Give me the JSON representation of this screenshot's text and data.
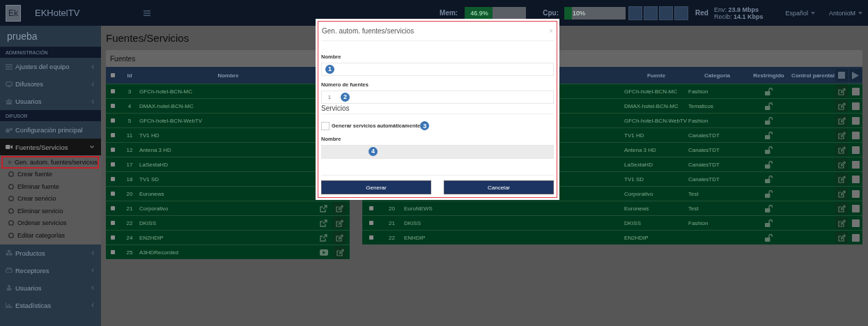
{
  "topbar": {
    "logo": "Ek",
    "brand": "EKHotelTV",
    "mem": {
      "label": "Mem:",
      "reading": "46.9%",
      "level": 0.45
    },
    "cpu": {
      "label": "Cpu:",
      "reading": "10%",
      "level": 0.12
    },
    "network": {
      "label": "Red",
      "sent": "Env: **23.9 Mbps**",
      "received": "Recib: **14.1 Kbps**"
    },
    "language": "Español",
    "user": "AntonioM"
  },
  "sidebar": {
    "title": "prueba",
    "sections": [
      {
        "header": "ADMINISTRACIÓN",
        "items": [
          {
            "label": "Ajustes del equipo",
            "kind": "list",
            "expanded": false
          },
          {
            "label": "Difusores",
            "kind": "monitor",
            "expanded": false
          },
          {
            "label": "Usuarios",
            "kind": "users",
            "expanded": false
          }
        ]
      },
      {
        "header": "DIFUSOR",
        "items": [
          {
            "label": "Configuración principal",
            "kind": "gears"
          },
          {
            "label": "Fuentes/Servicios",
            "kind": "video",
            "expanded": true,
            "children": [
              {
                "label": "Gen. autom. fuentes/servicios",
                "selected": true
              },
              {
                "label": "Crear fuente",
                "selected": false
              },
              {
                "label": "Eliminar fuente",
                "selected": false
              },
              {
                "label": "Crear servicio",
                "selected": false
              },
              {
                "label": "Eliminar servicio",
                "selected": false
              },
              {
                "label": "Ordenar servicios",
                "selected": false
              },
              {
                "label": "Editar categorías",
                "selected": false
              }
            ]
          },
          {
            "label": "Productos",
            "kind": "cubes",
            "expanded": false
          },
          {
            "label": "Receptores",
            "kind": "printer",
            "expanded": false
          },
          {
            "label": "Usuarios",
            "kind": "user",
            "expanded": false
          },
          {
            "label": "Estadísticas",
            "kind": "chart",
            "expanded": false
          }
        ]
      }
    ]
  },
  "page_title": "Fuentes/Servicios",
  "sources": {
    "title": "Fuentes",
    "all_checked": false,
    "columns": [
      "Id",
      "Nombre"
    ],
    "rows": [
      {
        "id": "3",
        "name": "GFCh-hotel-BCN-MC",
        "checked": false
      },
      {
        "id": "4",
        "name": "DMAX-hotel-BCN-MC",
        "checked": false
      },
      {
        "id": "5",
        "name": "GFCh-hotel-BCN-WebTV",
        "checked": false
      },
      {
        "id": "11",
        "name": "TV1 HD",
        "checked": false
      },
      {
        "id": "12",
        "name": "Antena 3 HD",
        "checked": false
      },
      {
        "id": "17",
        "name": "LaSextaHD",
        "checked": false
      },
      {
        "id": "18",
        "name": "TV1 SD",
        "checked": false
      },
      {
        "id": "20",
        "name": "Euronews",
        "checked": false
      },
      {
        "id": "21",
        "name": "Corporativo",
        "checked": false,
        "kind": "link"
      },
      {
        "id": "22",
        "name": "DKISS",
        "checked": false,
        "kind": "link"
      },
      {
        "id": "24",
        "name": "EN2HDIP",
        "checked": false,
        "kind": "link"
      },
      {
        "id": "25",
        "name": "A3HDRecorded",
        "checked": false,
        "kind": "video"
      }
    ]
  },
  "services": {
    "columns": [
      "Fuente",
      "Categoría",
      "Restringido",
      "Control parental"
    ],
    "rows": [
      {
        "fuente": "GFCh-hotel-BCN-MC",
        "categoria": "Fashion",
        "restricted": false
      },
      {
        "fuente": "DMAX-hotel-BCN-MC",
        "categoria": "Tematicos",
        "restricted": false
      },
      {
        "fuente": "GFCh-hotel-BCN-WebTV",
        "categoria": "Fashion",
        "restricted": false
      },
      {
        "fuente": "TV1 HD",
        "categoria": "CanalesTDT",
        "restricted": false
      },
      {
        "fuente": "Antena 3 HD",
        "categoria": "CanalesTDT",
        "restricted": false
      },
      {
        "fuente": "LaSextaHD",
        "categoria": "CanalesTDT",
        "restricted": false
      },
      {
        "fuente": "TV1 SD",
        "categoria": "CanalesTDT",
        "restricted": false
      },
      {
        "fuente": "Corporativo",
        "categoria": "Test",
        "restricted": false
      },
      {
        "id": "20",
        "name": "EuroNEWS",
        "checked": false,
        "fuente": "Euronews",
        "categoria": "Test",
        "restricted": false
      },
      {
        "id": "21",
        "name": "DKISS",
        "checked": false,
        "fuente": "DKISS",
        "categoria": "Fashion",
        "restricted": false
      },
      {
        "id": "22",
        "name": "ENHDIP",
        "checked": false,
        "fuente": "EN2HDIP",
        "restricted": false
      }
    ]
  },
  "modal": {
    "title": "Gen. autom. fuentes/servicios",
    "close": "×",
    "fields": [
      {
        "label": "Nombre",
        "badge": "1",
        "disabled": false
      },
      {
        "label": "Número de fuentes",
        "value": "1",
        "badge": "2",
        "disabled": false
      }
    ],
    "section": "Servicios",
    "checkbox": {
      "label": "Generar servicios automáticamente",
      "checked": false,
      "badge": "3"
    },
    "fields2": [
      {
        "label": "Nombre",
        "badge": "4",
        "disabled": true
      }
    ],
    "buttons": [
      "Generar",
      "Cancelar"
    ]
  }
}
